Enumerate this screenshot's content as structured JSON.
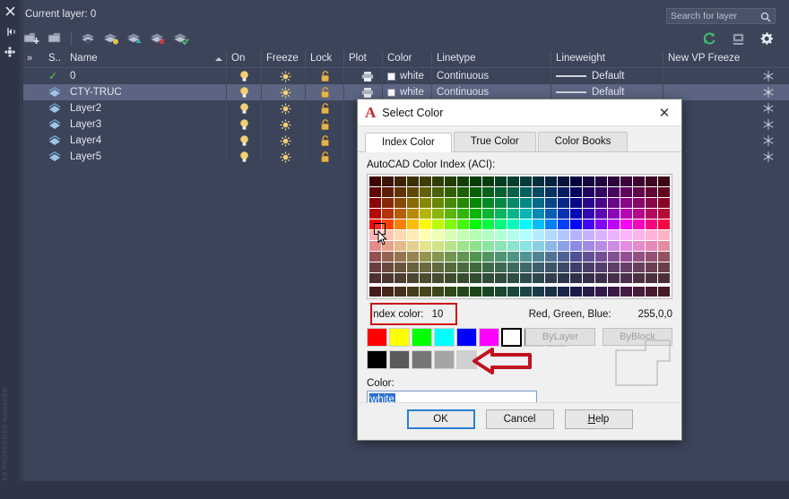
{
  "palette": {
    "current_layer_label": "Current layer: 0",
    "search": {
      "placeholder": "Search for layer"
    },
    "vertical_label": "LAYER PROPERTIES MANAGER",
    "icons": {
      "close": "close-icon",
      "autohide": "auto-hide-icon",
      "properties": "properties-icon",
      "search": "search-icon",
      "refresh": "refresh-icon",
      "layer_state": "layer-state-icon",
      "settings": "gear-icon"
    },
    "toolbar": [
      {
        "name": "new-layer-button",
        "title": "New Layer"
      },
      {
        "name": "new-layer-vp-frozen-button",
        "title": "New Layer VP Frozen in All Viewports"
      },
      {
        "name": "layer-states-manager-button",
        "title": "Layer States Manager"
      },
      {
        "name": "set-current-button",
        "title": "Set Current"
      },
      {
        "name": "isolate-layer-button",
        "title": "Isolate"
      },
      {
        "name": "delete-layer-button",
        "title": "Delete Layer"
      },
      {
        "name": "make-current-button",
        "title": "Make Current"
      }
    ],
    "columns": [
      {
        "key": "status",
        "label": "S.."
      },
      {
        "key": "name",
        "label": "Name"
      },
      {
        "key": "on",
        "label": "On"
      },
      {
        "key": "freeze",
        "label": "Freeze"
      },
      {
        "key": "lock",
        "label": "Lock"
      },
      {
        "key": "plot",
        "label": "Plot"
      },
      {
        "key": "color",
        "label": "Color"
      },
      {
        "key": "linetype",
        "label": "Linetype"
      },
      {
        "key": "lineweight",
        "label": "Lineweight"
      },
      {
        "key": "newvpfreeze",
        "label": "New VP Freeze"
      }
    ],
    "expand_chevron": "»",
    "rows": [
      {
        "status": "current",
        "name": "0",
        "color": "white",
        "linetype": "Continuous",
        "lineweight": "Default",
        "selected": false
      },
      {
        "status": "layer",
        "name": "CTY-TRUC",
        "color": "white",
        "linetype": "Continuous",
        "lineweight": "Default",
        "selected": true
      },
      {
        "status": "layer",
        "name": "Layer2",
        "color": "",
        "linetype": "",
        "lineweight": "",
        "selected": false
      },
      {
        "status": "layer",
        "name": "Layer3",
        "color": "",
        "linetype": "",
        "lineweight": "",
        "selected": false
      },
      {
        "status": "layer",
        "name": "Layer4",
        "color": "",
        "linetype": "",
        "lineweight": "",
        "selected": false
      },
      {
        "status": "layer",
        "name": "Layer5",
        "color": "",
        "linetype": "",
        "lineweight": "",
        "selected": false
      }
    ]
  },
  "dialog": {
    "title": "Select Color",
    "logo": "autocad-a-logo",
    "close_label": "✕",
    "tabs": [
      {
        "label": "Index Color",
        "active": true
      },
      {
        "label": "True Color",
        "active": false
      },
      {
        "label": "Color Books",
        "active": false
      }
    ],
    "aci_label": "AutoCAD Color Index (ACI):",
    "index_color_label": "Index color:",
    "index_color_value": "10",
    "rgb_label": "Red, Green, Blue:",
    "rgb_value": "255,0,0",
    "bylayer_label": "ByLayer",
    "byblock_label": "ByBlock",
    "color_label": "Color:",
    "color_value": "white",
    "buttons": {
      "ok": "OK",
      "cancel": "Cancel",
      "help": "Help"
    },
    "annotation": {
      "highlight_color": "#cc1111",
      "arrow": "red-left-arrow"
    },
    "standard_swatches_row1": [
      "#ff0000",
      "#ffff00",
      "#00ff00",
      "#00ffff",
      "#0000ff",
      "#ff00ff",
      "#ffffff",
      "#808080",
      "#c0c0c0"
    ],
    "standard_swatches_row2": [
      "#000000",
      "#5a5a5a",
      "#777777",
      "#a5a5a5",
      "#d0d0d0"
    ],
    "selected_swatch_index": 6
  },
  "theme": {
    "panel_bg": "#3c445a",
    "strip_bg": "#2e3547",
    "row_selected": "#5b6480",
    "text": "#e3e7ee",
    "dialog_bg": "#f0f0f0",
    "accent_red": "#cc1111",
    "focus_blue": "#2a7fd4"
  }
}
